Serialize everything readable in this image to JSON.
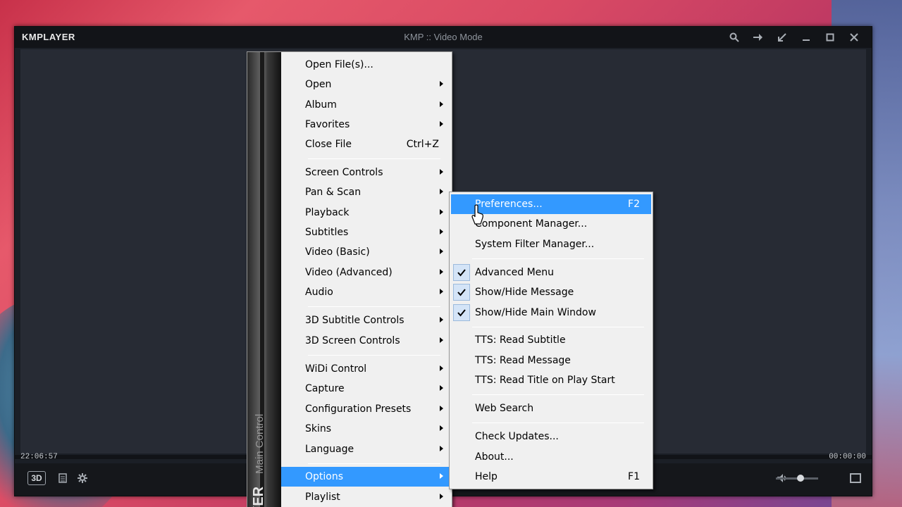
{
  "window": {
    "logo": "KMPLAYER",
    "title": "KMP :: Video Mode",
    "time_elapsed": "22:06:57",
    "time_total": "00:00:00",
    "three_d_label": "3D"
  },
  "main_menu": {
    "sidebar_bold": "YER",
    "sidebar_text": "Main Control",
    "items": [
      {
        "label": "Open File(s)...",
        "shortcut": ""
      },
      {
        "label": "Open",
        "shortcut": ""
      },
      {
        "label": "Album",
        "shortcut": ""
      },
      {
        "label": "Favorites",
        "shortcut": ""
      },
      {
        "label": "Close File",
        "shortcut": "Ctrl+Z"
      },
      {
        "label": "Screen Controls",
        "shortcut": ""
      },
      {
        "label": "Pan & Scan",
        "shortcut": ""
      },
      {
        "label": "Playback",
        "shortcut": ""
      },
      {
        "label": "Subtitles",
        "shortcut": ""
      },
      {
        "label": "Video (Basic)",
        "shortcut": ""
      },
      {
        "label": "Video (Advanced)",
        "shortcut": ""
      },
      {
        "label": "Audio",
        "shortcut": ""
      },
      {
        "label": "3D Subtitle Controls",
        "shortcut": ""
      },
      {
        "label": "3D Screen Controls",
        "shortcut": ""
      },
      {
        "label": "WiDi Control",
        "shortcut": ""
      },
      {
        "label": "Capture",
        "shortcut": ""
      },
      {
        "label": "Configuration Presets",
        "shortcut": ""
      },
      {
        "label": "Skins",
        "shortcut": ""
      },
      {
        "label": "Language",
        "shortcut": ""
      },
      {
        "label": "Options",
        "shortcut": ""
      },
      {
        "label": "Playlist",
        "shortcut": ""
      }
    ]
  },
  "options_menu": {
    "items": [
      {
        "label": "Preferences...",
        "shortcut": "F2"
      },
      {
        "label": "Component Manager...",
        "shortcut": ""
      },
      {
        "label": "System Filter Manager...",
        "shortcut": ""
      },
      {
        "label": "Advanced Menu",
        "shortcut": "",
        "checked": true
      },
      {
        "label": "Show/Hide Message",
        "shortcut": "",
        "checked": true
      },
      {
        "label": "Show/Hide Main Window",
        "shortcut": "",
        "checked": true
      },
      {
        "label": "TTS: Read Subtitle",
        "shortcut": ""
      },
      {
        "label": "TTS: Read Message",
        "shortcut": ""
      },
      {
        "label": "TTS: Read Title on Play Start",
        "shortcut": ""
      },
      {
        "label": "Web Search",
        "shortcut": ""
      },
      {
        "label": "Check Updates...",
        "shortcut": ""
      },
      {
        "label": "About...",
        "shortcut": ""
      },
      {
        "label": "Help",
        "shortcut": "F1"
      }
    ]
  },
  "colors": {
    "highlight": "#3399ff",
    "menu_bg": "#f0f0f0",
    "player_bg": "#1b1f26"
  }
}
